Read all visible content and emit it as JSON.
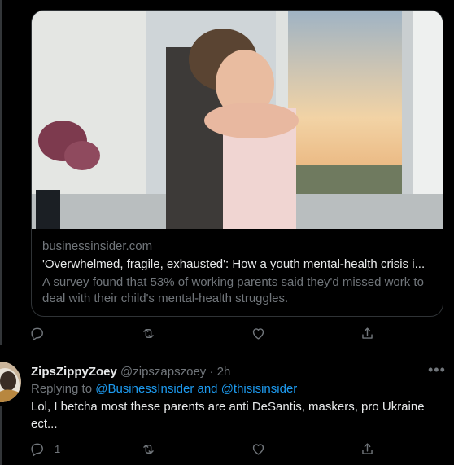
{
  "link_card": {
    "domain": "businessinsider.com",
    "headline": "'Overwhelmed, fragile, exhausted': How a youth mental-health crisis i...",
    "description": "A survey found that 53% of working parents said they'd missed work to deal with their child's mental-health struggles."
  },
  "tweet_actions": {
    "reply_icon": "reply-icon",
    "retweet_icon": "retweet-icon",
    "like_icon": "heart-icon",
    "share_icon": "share-icon"
  },
  "reply_tweet": {
    "display_name": "ZipsZippyZoey",
    "handle": "@zipszapszoey",
    "separator": "·",
    "time": "2h",
    "replying_prefix": "Replying to ",
    "replying_mentions": "@BusinessInsider and @thisisinsider",
    "text": "Lol, I betcha most these parents are anti DeSantis, maskers, pro Ukraine ect...",
    "more_icon": "•••",
    "reply_count": "1"
  },
  "colors": {
    "background": "#000000",
    "text_primary": "#e7e9ea",
    "text_secondary": "#71767b",
    "accent": "#1d9bf0",
    "border": "#2f3336"
  }
}
